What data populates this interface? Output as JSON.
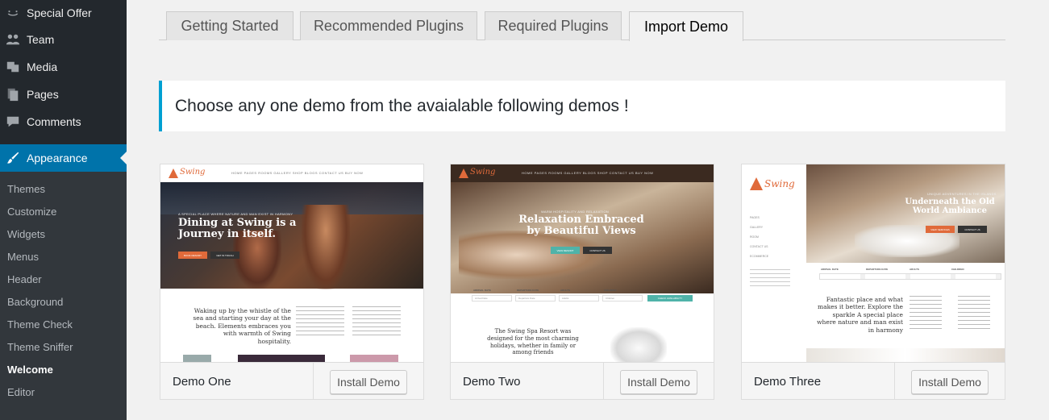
{
  "sidebar": {
    "items": [
      {
        "label": "Special Offer",
        "icon": "smile-icon"
      },
      {
        "label": "Team",
        "icon": "team-icon"
      },
      {
        "label": "Media",
        "icon": "media-icon"
      },
      {
        "label": "Pages",
        "icon": "pages-icon"
      },
      {
        "label": "Comments",
        "icon": "comments-icon"
      }
    ],
    "active": {
      "label": "Appearance",
      "icon": "paintbrush-icon"
    },
    "submenu": [
      "Themes",
      "Customize",
      "Widgets",
      "Menus",
      "Header",
      "Background",
      "Theme Check",
      "Theme Sniffer",
      "Welcome",
      "Editor"
    ],
    "current_submenu": "Welcome"
  },
  "tabs": [
    "Getting Started",
    "Recommended Plugins",
    "Required Plugins",
    "Import Demo"
  ],
  "active_tab": "Import Demo",
  "notice": "Choose any one demo from the avaialable following demos !",
  "demos": [
    {
      "name": "Demo One",
      "button": "Install Demo",
      "preview": {
        "logo": "Swing",
        "nav": "HOME   PAGES   ROOMS   GALLERY   SHOP   BLOGS   CONTACT US   BUY NOW",
        "kicker": "A SPECIAL PLACE WHERE NATURE AND MAN EXIST IN HARMONY",
        "title": "Dining at Swing is a Journey in itself.",
        "btn1": "BOOK RESORT",
        "btn2": "GET IN TOUCH",
        "body": "Waking up by the whistle of the sea and starting your day at the beach. Elements embraces you with warmth of Swing hospitality."
      }
    },
    {
      "name": "Demo Two",
      "button": "Install Demo",
      "preview": {
        "logo": "Swing",
        "nav": "HOME   PAGES   ROOMS   GALLERY   BLOGS   SHOP   CONTACT US   BUY NOW",
        "kicker": "WARM HOSPITALITY AND RELAXATION",
        "title": "Relaxation Embraced by Beautiful Views",
        "btn1": "VIEW RESORT",
        "btn2": "CONTACT US",
        "labels": [
          "ARRIVAL DATE",
          "DEPARTURE DATE",
          "ADULTS",
          "CHILDREN"
        ],
        "fields": [
          "Arrival Date",
          "Departure Date",
          "Adults",
          "Children"
        ],
        "check": "CHECK AVAILABILITY",
        "body": "The Swing Spa Resort was designed for the most charming holidays, whether in family or among friends"
      }
    },
    {
      "name": "Demo Three",
      "button": "Install Demo",
      "preview": {
        "logo": "Swing",
        "menu": [
          "PAGES",
          "GALLERY",
          "ROOM",
          "CONTACT US",
          "ECOMMERCE"
        ],
        "kicker": "UNIQUE ADVENTURES IN THE ISLANDS",
        "title": "Underneath the Old World Ambiance",
        "btn1": "VIEW SERVICES",
        "btn2": "CONTACT US",
        "labels": [
          "ARRIVAL DATE",
          "DEPARTURE DATE",
          "ADULTS",
          "CHILDREN"
        ],
        "body": "Fantastic place and what makes it better. Explore the sparkle A special place where nature and man exist in harmony"
      }
    }
  ],
  "colors": {
    "accent": "#0073aa",
    "notice_border": "#00a0d2",
    "sidebar": "#23282d",
    "brand": "#e06a3a"
  }
}
